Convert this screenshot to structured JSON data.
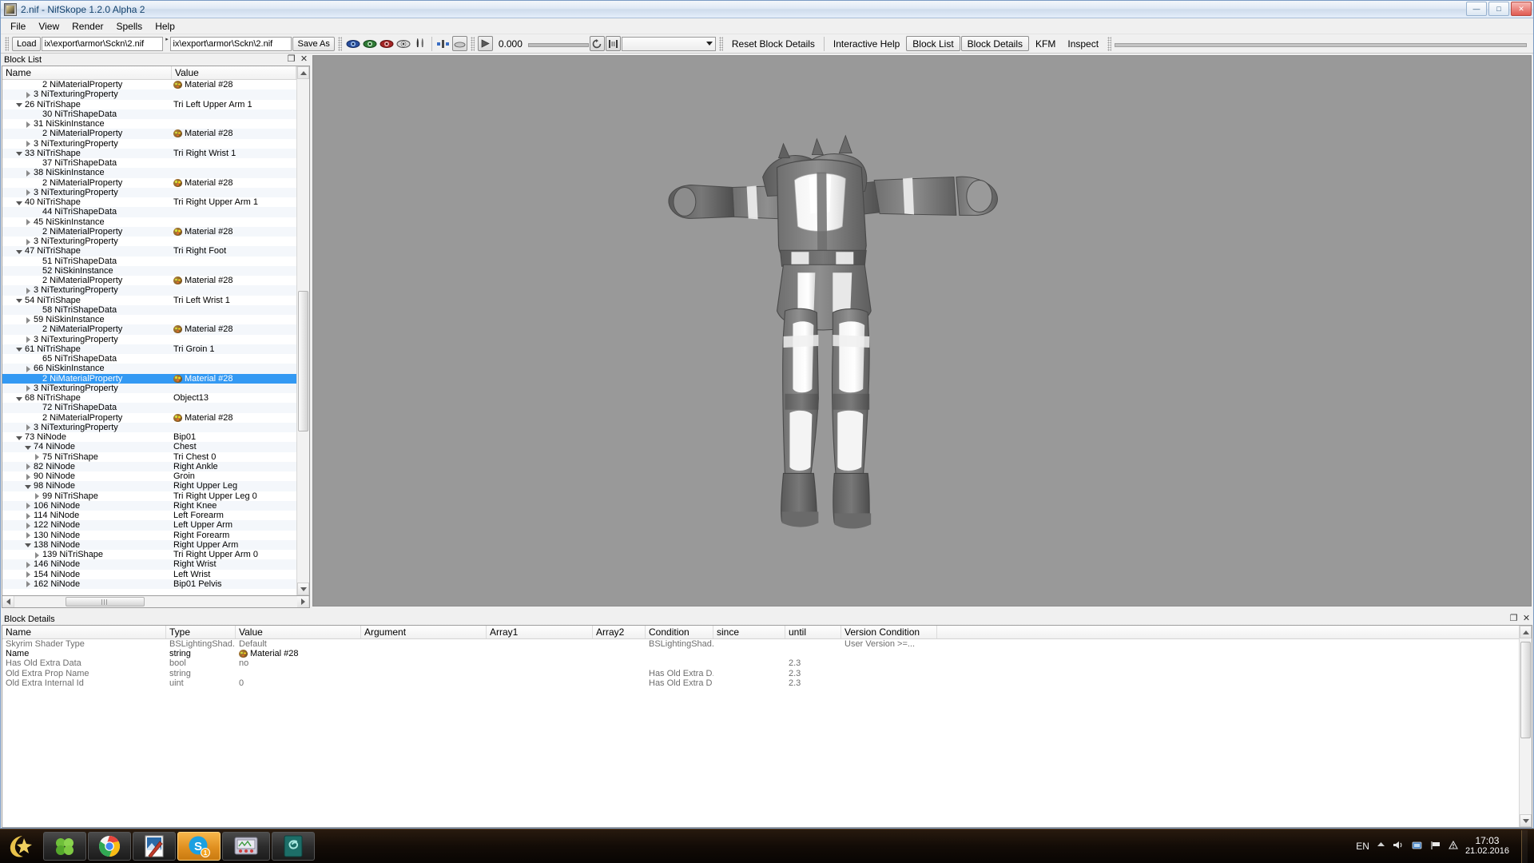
{
  "window": {
    "title": "2.nif - NifSkope 1.2.0 Alpha 2",
    "minimize": "—",
    "maximize": "□",
    "close": "✕"
  },
  "menu": [
    "File",
    "View",
    "Render",
    "Spells",
    "Help"
  ],
  "toolbar": {
    "load_label": "Load",
    "path_open": "ix\\export\\armor\\Sckn\\2.nif",
    "path_save": "ix\\export\\armor\\Sckn\\2.nif",
    "save_as_label": "Save As",
    "anim_value": "0.000",
    "combo_value": "",
    "reset_block_details": "Reset Block Details",
    "interactive_help": "Interactive Help",
    "block_list": "Block List",
    "block_details": "Block Details",
    "kfm": "KFM",
    "inspect": "Inspect"
  },
  "blocklist": {
    "title": "Block List",
    "float_btn": "❐",
    "close_btn": "✕",
    "columns": [
      "Name",
      "Value"
    ],
    "rows": [
      {
        "indent": 3,
        "exp": "none",
        "name": "2 NiMaterialProperty",
        "value": "Material #28",
        "mat": true
      },
      {
        "indent": 2,
        "exp": "closed",
        "name": "3 NiTexturingProperty",
        "value": ""
      },
      {
        "indent": 1,
        "exp": "open",
        "name": "26 NiTriShape",
        "value": "Tri Left Upper Arm 1"
      },
      {
        "indent": 3,
        "exp": "none",
        "name": "30 NiTriShapeData",
        "value": ""
      },
      {
        "indent": 2,
        "exp": "closed",
        "name": "31 NiSkinInstance",
        "value": ""
      },
      {
        "indent": 3,
        "exp": "none",
        "name": "2 NiMaterialProperty",
        "value": "Material #28",
        "mat": true
      },
      {
        "indent": 2,
        "exp": "closed",
        "name": "3 NiTexturingProperty",
        "value": ""
      },
      {
        "indent": 1,
        "exp": "open",
        "name": "33 NiTriShape",
        "value": "Tri Right Wrist 1"
      },
      {
        "indent": 3,
        "exp": "none",
        "name": "37 NiTriShapeData",
        "value": ""
      },
      {
        "indent": 2,
        "exp": "closed",
        "name": "38 NiSkinInstance",
        "value": ""
      },
      {
        "indent": 3,
        "exp": "none",
        "name": "2 NiMaterialProperty",
        "value": "Material #28",
        "mat": true
      },
      {
        "indent": 2,
        "exp": "closed",
        "name": "3 NiTexturingProperty",
        "value": ""
      },
      {
        "indent": 1,
        "exp": "open",
        "name": "40 NiTriShape",
        "value": "Tri Right Upper Arm 1"
      },
      {
        "indent": 3,
        "exp": "none",
        "name": "44 NiTriShapeData",
        "value": ""
      },
      {
        "indent": 2,
        "exp": "closed",
        "name": "45 NiSkinInstance",
        "value": ""
      },
      {
        "indent": 3,
        "exp": "none",
        "name": "2 NiMaterialProperty",
        "value": "Material #28",
        "mat": true
      },
      {
        "indent": 2,
        "exp": "closed",
        "name": "3 NiTexturingProperty",
        "value": ""
      },
      {
        "indent": 1,
        "exp": "open",
        "name": "47 NiTriShape",
        "value": "Tri Right Foot"
      },
      {
        "indent": 3,
        "exp": "none",
        "name": "51 NiTriShapeData",
        "value": ""
      },
      {
        "indent": 3,
        "exp": "none",
        "name": "52 NiSkinInstance",
        "value": ""
      },
      {
        "indent": 3,
        "exp": "none",
        "name": "2 NiMaterialProperty",
        "value": "Material #28",
        "mat": true
      },
      {
        "indent": 2,
        "exp": "closed",
        "name": "3 NiTexturingProperty",
        "value": ""
      },
      {
        "indent": 1,
        "exp": "open",
        "name": "54 NiTriShape",
        "value": "Tri Left Wrist 1"
      },
      {
        "indent": 3,
        "exp": "none",
        "name": "58 NiTriShapeData",
        "value": ""
      },
      {
        "indent": 2,
        "exp": "closed",
        "name": "59 NiSkinInstance",
        "value": ""
      },
      {
        "indent": 3,
        "exp": "none",
        "name": "2 NiMaterialProperty",
        "value": "Material #28",
        "mat": true
      },
      {
        "indent": 2,
        "exp": "closed",
        "name": "3 NiTexturingProperty",
        "value": ""
      },
      {
        "indent": 1,
        "exp": "open",
        "name": "61 NiTriShape",
        "value": "Tri Groin 1"
      },
      {
        "indent": 3,
        "exp": "none",
        "name": "65 NiTriShapeData",
        "value": ""
      },
      {
        "indent": 2,
        "exp": "closed",
        "name": "66 NiSkinInstance",
        "value": ""
      },
      {
        "indent": 3,
        "exp": "none",
        "name": "2 NiMaterialProperty",
        "value": "Material #28",
        "mat": true,
        "selected": true
      },
      {
        "indent": 2,
        "exp": "closed",
        "name": "3 NiTexturingProperty",
        "value": ""
      },
      {
        "indent": 1,
        "exp": "open",
        "name": "68 NiTriShape",
        "value": "Object13"
      },
      {
        "indent": 3,
        "exp": "none",
        "name": "72 NiTriShapeData",
        "value": ""
      },
      {
        "indent": 3,
        "exp": "none",
        "name": "2 NiMaterialProperty",
        "value": "Material #28",
        "mat": true
      },
      {
        "indent": 2,
        "exp": "closed",
        "name": "3 NiTexturingProperty",
        "value": ""
      },
      {
        "indent": 1,
        "exp": "open",
        "name": "73 NiNode",
        "value": "Bip01"
      },
      {
        "indent": 2,
        "exp": "open",
        "name": "74 NiNode",
        "value": "Chest"
      },
      {
        "indent": 3,
        "exp": "closed",
        "name": "75 NiTriShape",
        "value": "Tri Chest 0"
      },
      {
        "indent": 2,
        "exp": "closed",
        "name": "82 NiNode",
        "value": "Right Ankle"
      },
      {
        "indent": 2,
        "exp": "closed",
        "name": "90 NiNode",
        "value": "Groin"
      },
      {
        "indent": 2,
        "exp": "open",
        "name": "98 NiNode",
        "value": "Right Upper Leg"
      },
      {
        "indent": 3,
        "exp": "closed",
        "name": "99 NiTriShape",
        "value": "Tri Right Upper Leg 0"
      },
      {
        "indent": 2,
        "exp": "closed",
        "name": "106 NiNode",
        "value": "Right Knee"
      },
      {
        "indent": 2,
        "exp": "closed",
        "name": "114 NiNode",
        "value": "Left Forearm"
      },
      {
        "indent": 2,
        "exp": "closed",
        "name": "122 NiNode",
        "value": "Left Upper Arm"
      },
      {
        "indent": 2,
        "exp": "closed",
        "name": "130 NiNode",
        "value": "Right Forearm"
      },
      {
        "indent": 2,
        "exp": "open",
        "name": "138 NiNode",
        "value": "Right Upper Arm"
      },
      {
        "indent": 3,
        "exp": "closed",
        "name": "139 NiTriShape",
        "value": "Tri Right Upper Arm 0"
      },
      {
        "indent": 2,
        "exp": "closed",
        "name": "146 NiNode",
        "value": "Right Wrist"
      },
      {
        "indent": 2,
        "exp": "closed",
        "name": "154 NiNode",
        "value": "Left Wrist"
      },
      {
        "indent": 2,
        "exp": "closed",
        "name": "162 NiNode",
        "value": "Bip01 Pelvis"
      }
    ]
  },
  "blockdetails": {
    "title": "Block Details",
    "float_btn": "❐",
    "close_btn": "✕",
    "columns": [
      "Name",
      "Type",
      "Value",
      "Argument",
      "Array1",
      "Array2",
      "Condition",
      "since",
      "until",
      "Version Condition"
    ],
    "rows": [
      {
        "name": "Skyrim Shader Type",
        "type": "BSLightingShad...",
        "value": "Default",
        "argument": "",
        "array1": "",
        "array2": "",
        "condition": "BSLightingShad...",
        "since": "",
        "until": "",
        "version_condition": "User Version >=..."
      },
      {
        "name": "Name",
        "type": "string",
        "value": "Material #28",
        "argument": "",
        "array1": "",
        "array2": "",
        "condition": "",
        "since": "",
        "until": "",
        "version_condition": "",
        "mat": true,
        "current": true
      },
      {
        "name": "Has Old Extra Data",
        "type": "bool",
        "value": "no",
        "argument": "",
        "array1": "",
        "array2": "",
        "condition": "",
        "since": "",
        "until": "2.3",
        "version_condition": ""
      },
      {
        "name": "Old Extra Prop Name",
        "type": "string",
        "value": "",
        "argument": "",
        "array1": "",
        "array2": "",
        "condition": "Has Old Extra D...",
        "since": "",
        "until": "2.3",
        "version_condition": ""
      },
      {
        "name": "Old Extra Internal Id",
        "type": "uint",
        "value": "0",
        "argument": "",
        "array1": "",
        "array2": "",
        "condition": "Has Old Extra D",
        "since": "",
        "until": "2.3",
        "version_condition": ""
      }
    ]
  },
  "taskbar": {
    "start_label": "start",
    "tasks": [
      {
        "name": "clover-app"
      },
      {
        "name": "chrome-browser"
      },
      {
        "name": "image-editor"
      },
      {
        "name": "skype",
        "badge": "1",
        "active": true
      },
      {
        "name": "system-monitor"
      },
      {
        "name": "nifskope"
      }
    ],
    "language": "EN",
    "time": "17:03",
    "date": "21.02.2016"
  }
}
